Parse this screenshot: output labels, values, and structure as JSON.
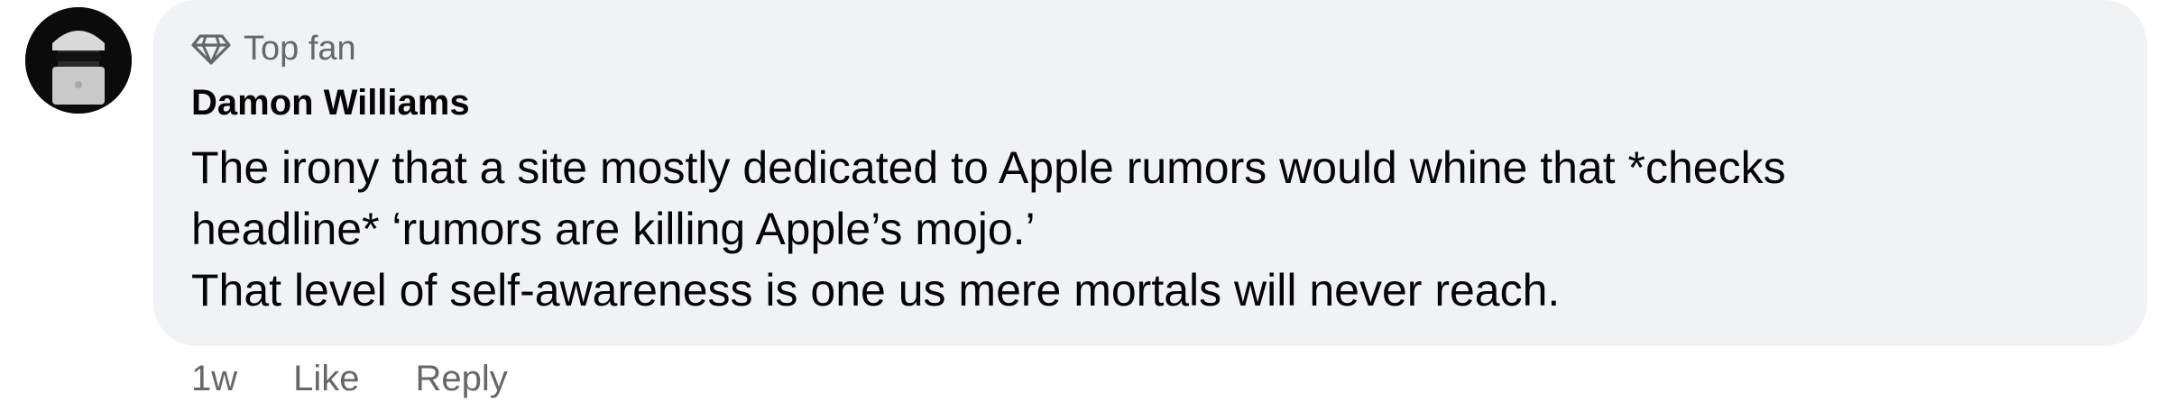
{
  "comment": {
    "avatar_icon": "profile-avatar",
    "badge": {
      "icon": "diamond-icon",
      "label": "Top fan"
    },
    "author": "Damon Williams",
    "body_lines": [
      "The irony that a site mostly dedicated to Apple rumors would whine that *checks",
      "headline* ‘rumors are killing Apple’s mojo.’",
      "That level of self-awareness is one us mere mortals will never reach."
    ],
    "actions": {
      "time": "1w",
      "like_label": "Like",
      "reply_label": "Reply"
    }
  },
  "colors": {
    "bubble_bg": "#f0f2f5",
    "secondary_text": "#65676b",
    "primary_text": "#050505"
  }
}
